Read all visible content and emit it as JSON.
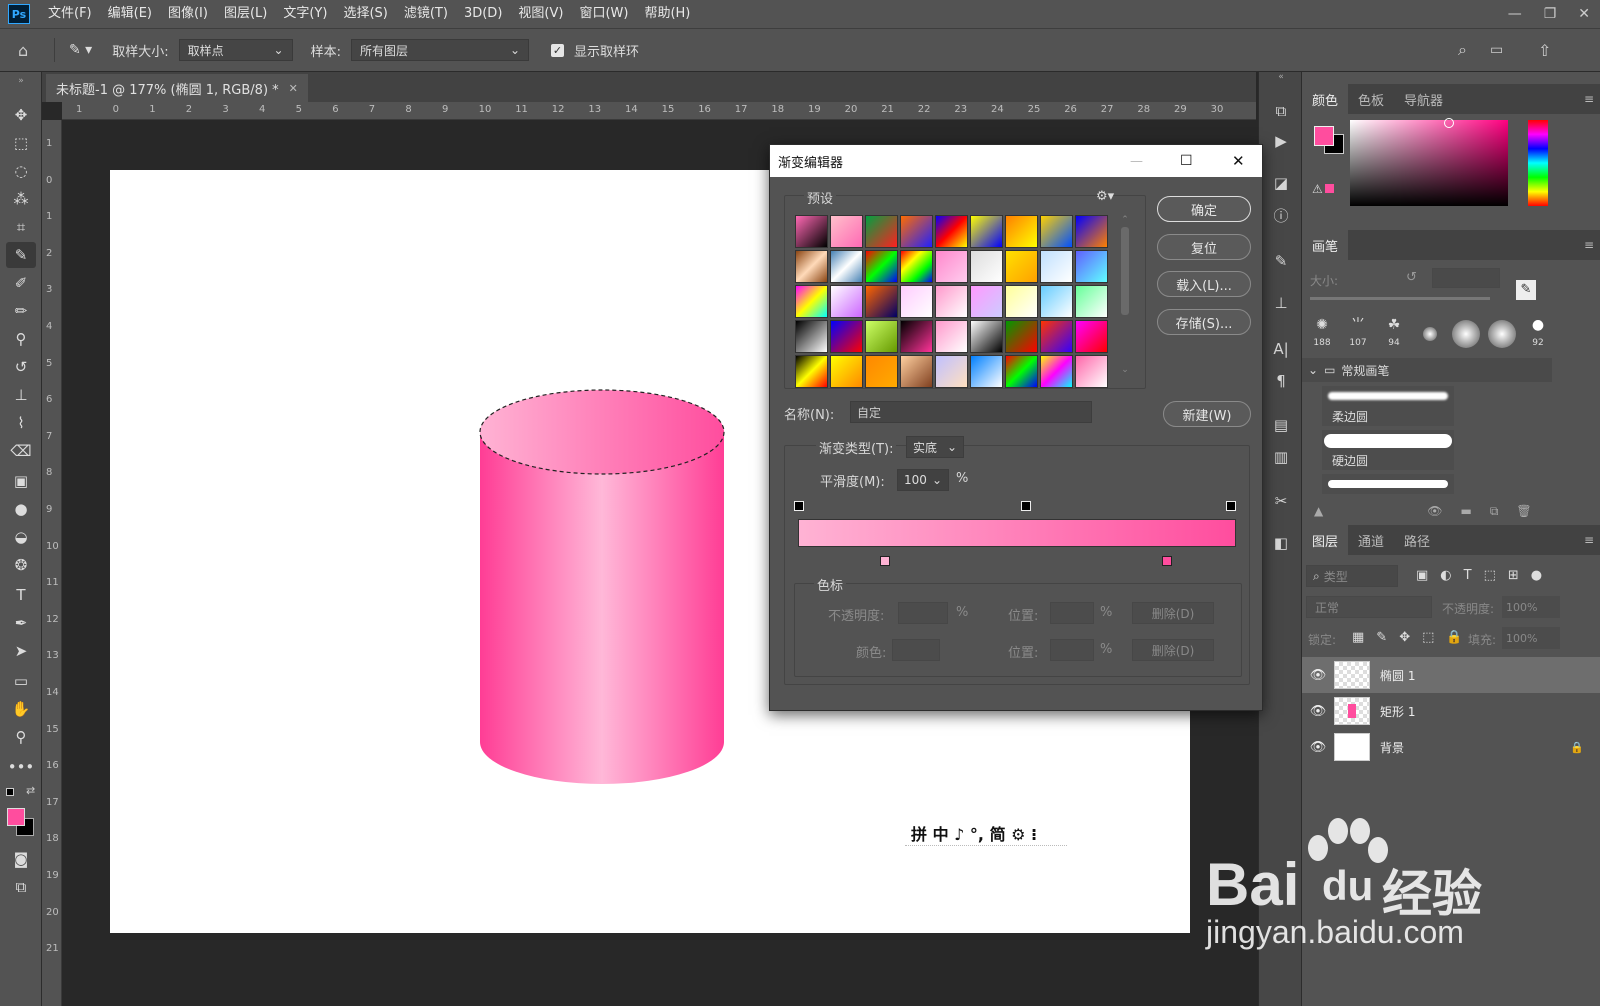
{
  "menubar": {
    "logo": "Ps",
    "items": [
      "文件(F)",
      "编辑(E)",
      "图像(I)",
      "图层(L)",
      "文字(Y)",
      "选择(S)",
      "滤镜(T)",
      "3D(D)",
      "视图(V)",
      "窗口(W)",
      "帮助(H)"
    ]
  },
  "options": {
    "sample_size_label": "取样大小:",
    "sample_size_value": "取样点",
    "sample_label": "样本:",
    "sample_value": "所有图层",
    "show_ring_label": "显示取样环"
  },
  "document": {
    "tab_title": "未标题-1 @ 177% (椭圆 1, RGB/8) *",
    "ruler_h": [
      "1",
      "0",
      "1",
      "2",
      "3",
      "4",
      "5",
      "6",
      "7",
      "8",
      "9",
      "10",
      "11",
      "12",
      "13",
      "14",
      "15",
      "16",
      "17",
      "18",
      "19",
      "20",
      "21",
      "22",
      "23",
      "24",
      "25",
      "26",
      "27",
      "28",
      "29",
      "30"
    ],
    "ruler_v": [
      "1",
      "0",
      "1",
      "2",
      "3",
      "4",
      "5",
      "6",
      "7",
      "8",
      "9",
      "10",
      "11",
      "12",
      "13",
      "14",
      "15",
      "16",
      "17",
      "18",
      "19",
      "20",
      "21"
    ]
  },
  "ime_bar": {
    "text": "拼 中 ♪ °, 简 ⚙ ⁝"
  },
  "dialog": {
    "title": "渐变编辑器",
    "presets_label": "预设",
    "buttons": {
      "ok": "确定",
      "reset": "复位",
      "load": "载入(L)...",
      "save": "存储(S)...",
      "new": "新建(W)"
    },
    "name_label": "名称(N):",
    "name_value": "自定",
    "gradient_type_label": "渐变类型(T):",
    "gradient_type_value": "实底",
    "smoothness_label": "平滑度(M):",
    "smoothness_value": "100",
    "percent": "%",
    "stops_group_label": "色标",
    "opacity_label": "不透明度:",
    "location_label": "位置:",
    "color_label": "颜色:",
    "delete_label": "删除(D)",
    "gradient_start": "#ffb3d4",
    "gradient_end": "#ff4d9e"
  },
  "panels": {
    "color_tabs": [
      "颜色",
      "色板",
      "导航器"
    ],
    "foreground": "#ff4d9e",
    "background": "#000000",
    "brush_tab": "画笔",
    "brush_size_label": "大小:",
    "brush_presets": [
      "188",
      "107",
      "94",
      "",
      "",
      "",
      "92"
    ],
    "brush_group": "常规画笔",
    "brush_items": [
      "柔边圆",
      "硬边圆"
    ],
    "layers_tabs": [
      "图层",
      "通道",
      "路径"
    ],
    "filter_placeholder": "类型",
    "blend_mode": "正常",
    "opacity_label": "不透明度:",
    "opacity_value": "100%",
    "lock_label": "锁定:",
    "fill_label": "填充:",
    "fill_value": "100%",
    "layers": [
      {
        "name": "椭圆 1"
      },
      {
        "name": "矩形 1"
      },
      {
        "name": "背景"
      }
    ]
  },
  "watermark": {
    "brand": "Bai",
    "brand2": "du",
    "label": "经验",
    "url": "jingyan.baidu.com"
  }
}
